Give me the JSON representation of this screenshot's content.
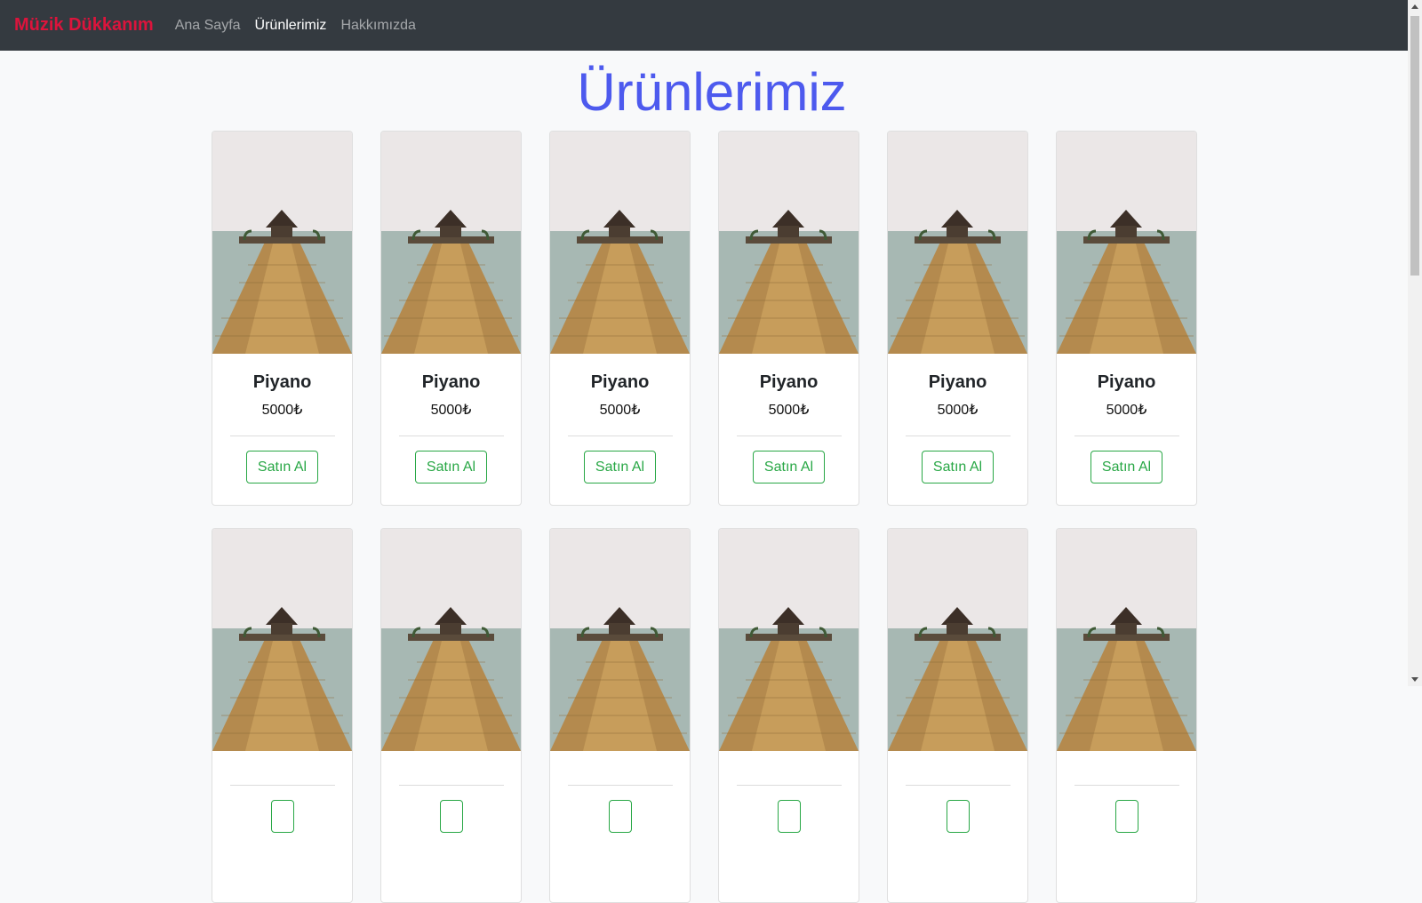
{
  "navbar": {
    "brand": "Müzik Dükkanım",
    "links": [
      "Ana Sayfa",
      "Ürünlerimiz",
      "Hakkımızda"
    ],
    "active_link": "Ürünlerimiz"
  },
  "page": {
    "title": "Ürünlerimiz"
  },
  "products": [
    {
      "name": "Piyano",
      "price": "5000₺",
      "button": "Satın Al",
      "image": "pier-pavilion-photo"
    },
    {
      "name": "Piyano",
      "price": "5000₺",
      "button": "Satın Al",
      "image": "pier-pavilion-photo"
    },
    {
      "name": "Piyano",
      "price": "5000₺",
      "button": "Satın Al",
      "image": "pier-pavilion-photo"
    },
    {
      "name": "Piyano",
      "price": "5000₺",
      "button": "Satın Al",
      "image": "pier-pavilion-photo"
    },
    {
      "name": "Piyano",
      "price": "5000₺",
      "button": "Satın Al",
      "image": "pier-pavilion-photo"
    },
    {
      "name": "Piyano",
      "price": "5000₺",
      "button": "Satın Al",
      "image": "pier-pavilion-photo"
    },
    {
      "name": "",
      "price": "",
      "button": "",
      "image": "pier-pavilion-photo"
    },
    {
      "name": "",
      "price": "",
      "button": "",
      "image": "pier-pavilion-photo"
    },
    {
      "name": "",
      "price": "",
      "button": "",
      "image": "pier-pavilion-photo"
    },
    {
      "name": "",
      "price": "",
      "button": "",
      "image": "pier-pavilion-photo"
    },
    {
      "name": "",
      "price": "",
      "button": "",
      "image": "pier-pavilion-photo"
    },
    {
      "name": "",
      "price": "",
      "button": "",
      "image": "pier-pavilion-photo"
    }
  ],
  "colors": {
    "brand": "#dc143c",
    "title": "#4d5aee",
    "button": "#28a745",
    "navbar": "#343a40"
  }
}
